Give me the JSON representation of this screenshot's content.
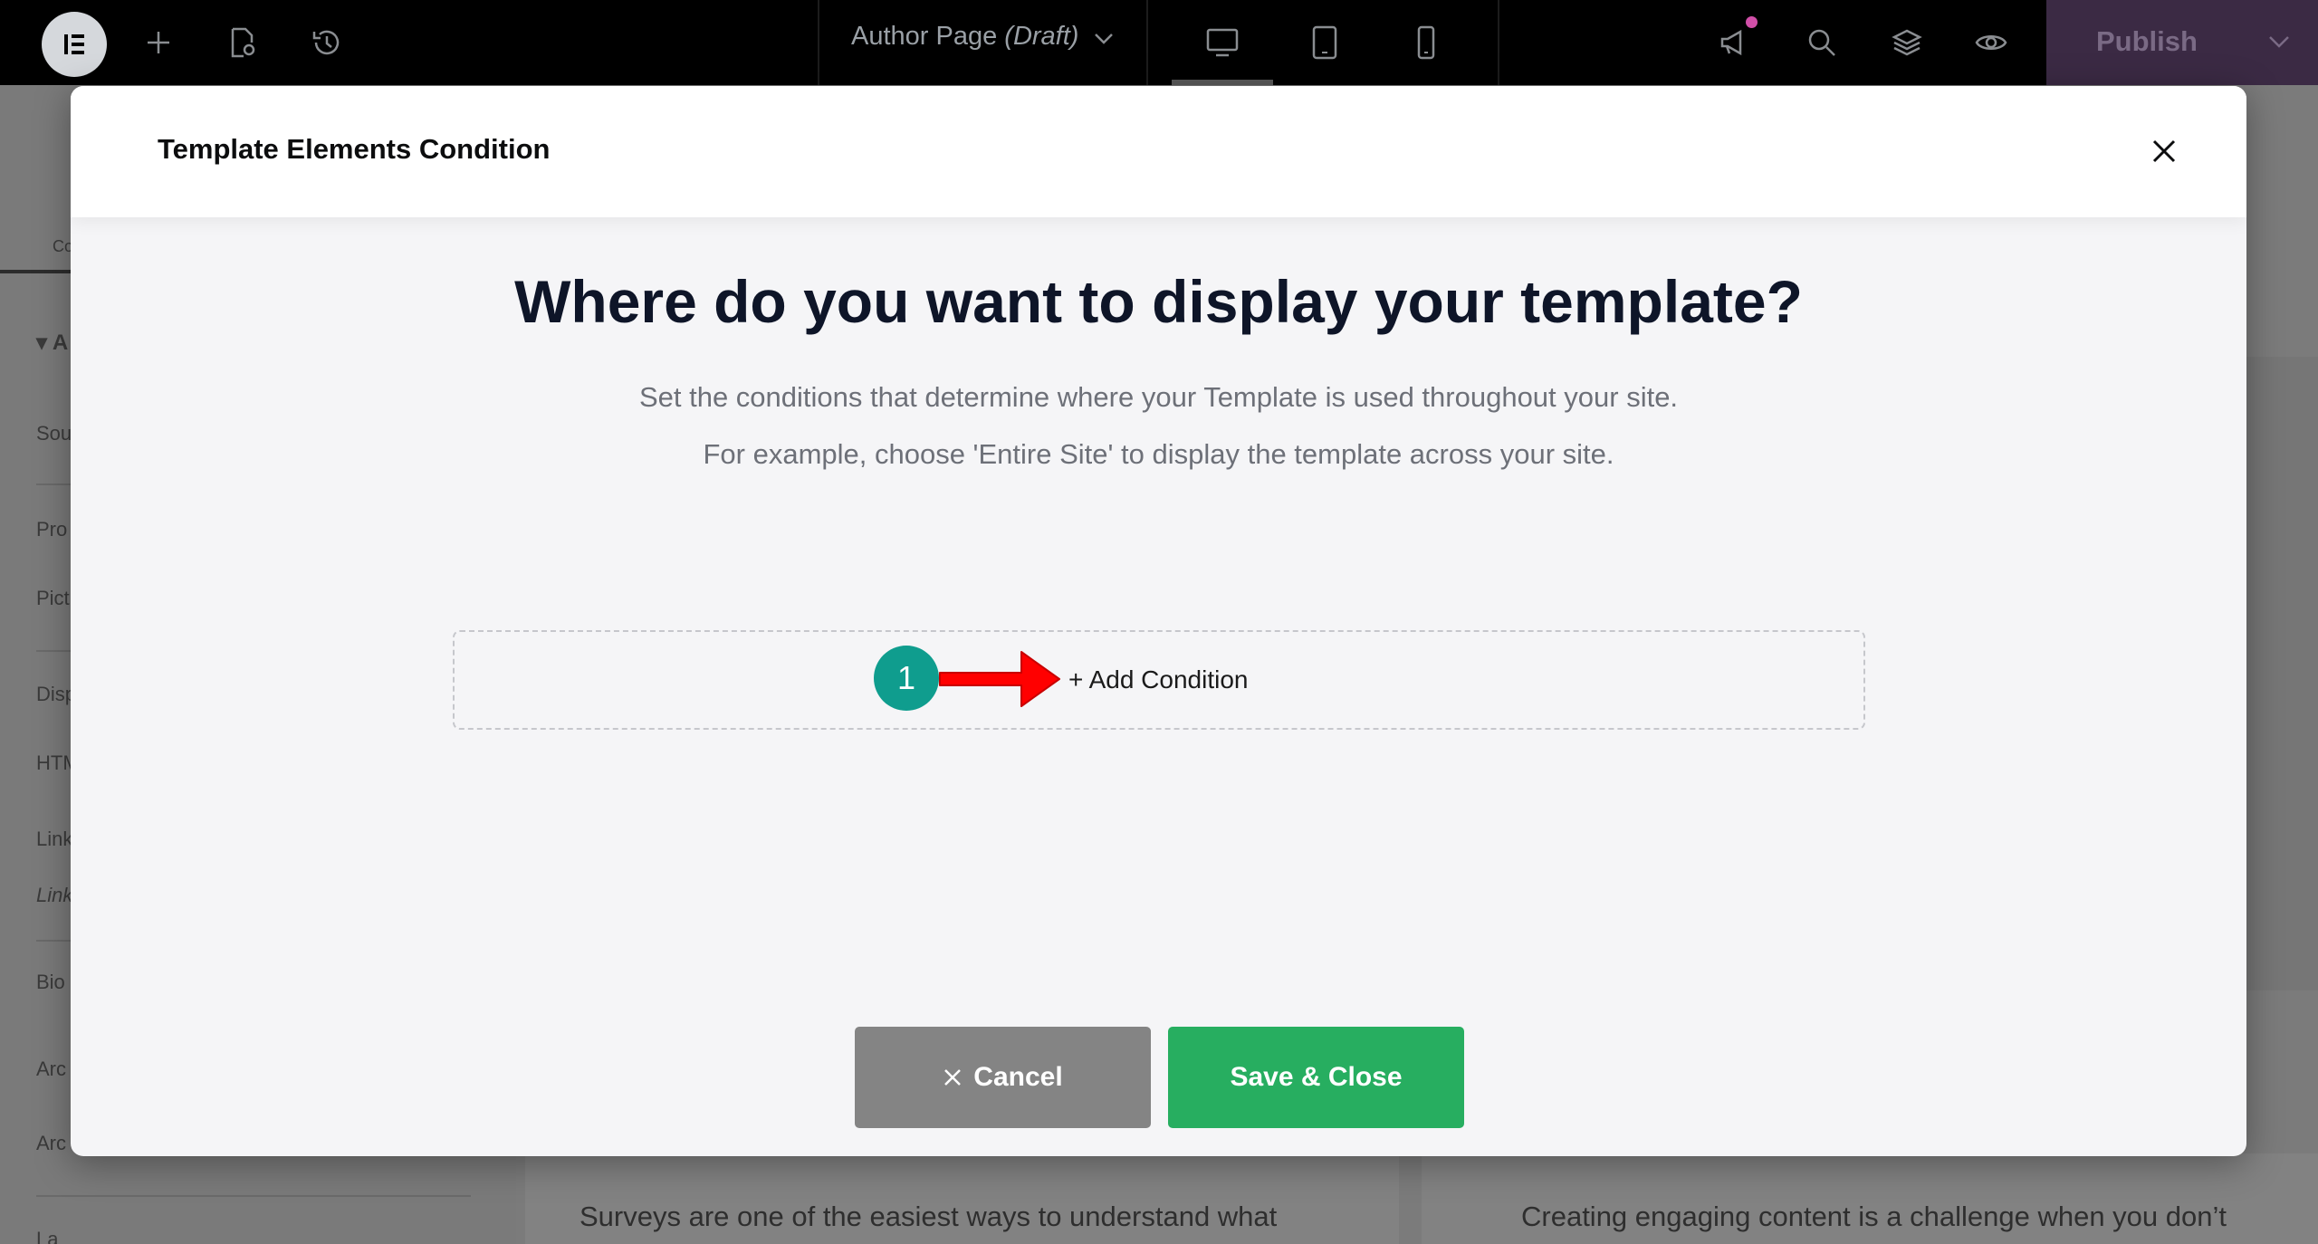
{
  "topbar": {
    "document_title": "Author Page",
    "document_status": "(Draft)",
    "publish_label": "Publish"
  },
  "background": {
    "panel_labels": [
      "Co",
      "A",
      "Sou",
      "Pro",
      "Pict",
      "Disp",
      "HTM",
      "Link",
      "Link",
      "Bio",
      "Arc",
      "Arc",
      "La"
    ],
    "canvas_text_left": "Surveys are one of the easiest ways to understand what",
    "canvas_text_right": "Creating engaging content is a challenge when you don’t"
  },
  "modal": {
    "title": "Template Elements Condition",
    "heading": "Where do you want to display your template?",
    "description_line1": "Set the conditions that determine where your Template is used throughout your site.",
    "description_line2": "For example, choose 'Entire Site' to display the template across your site.",
    "add_condition_label": "+ Add Condition",
    "step_number": "1",
    "cancel_label": "Cancel",
    "save_label": "Save & Close"
  },
  "colors": {
    "save_button": "#27ae60",
    "cancel_button": "#848484",
    "step_badge": "#0f9d8e",
    "arrow": "#ff0000",
    "publish_bg": "#3b2a44"
  },
  "icons": {
    "logo": "elementor-logo-icon",
    "add": "plus-icon",
    "page_settings": "page-settings-icon",
    "history": "history-icon",
    "desktop": "desktop-icon",
    "tablet": "tablet-icon",
    "mobile": "mobile-icon",
    "notifications": "megaphone-icon",
    "search": "search-icon",
    "structure": "layers-icon",
    "preview": "eye-icon",
    "close": "close-icon"
  }
}
